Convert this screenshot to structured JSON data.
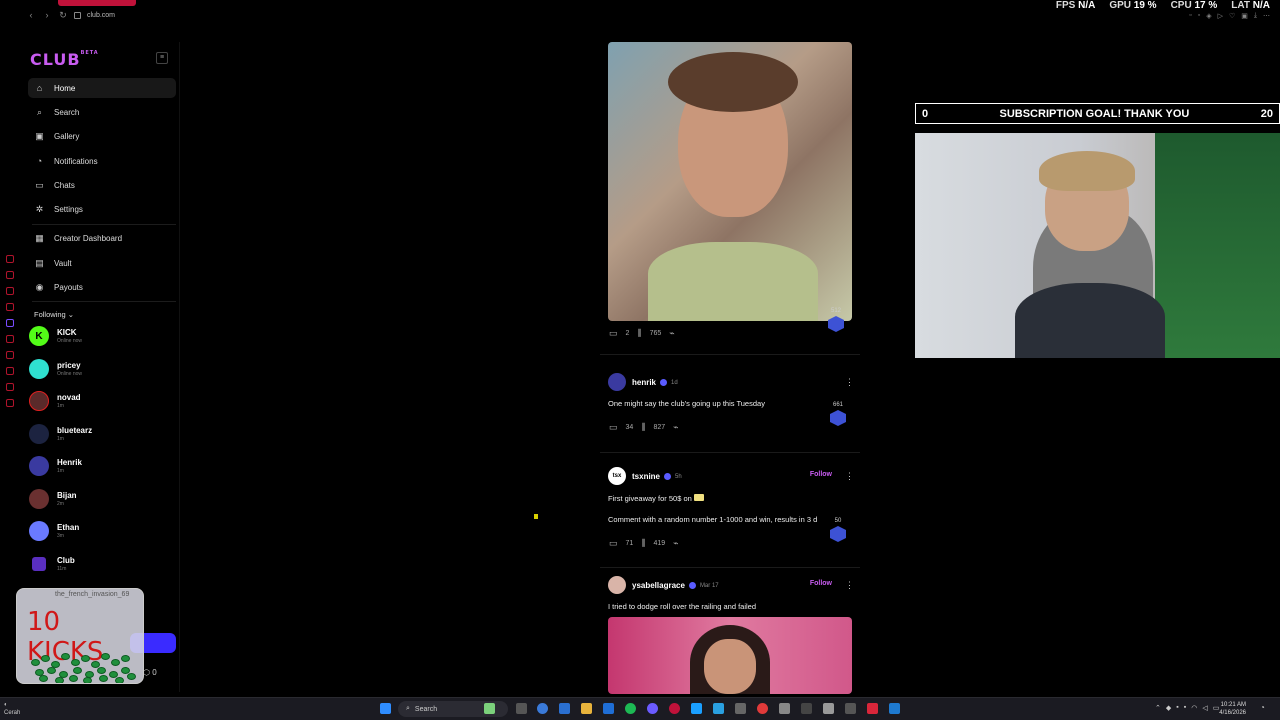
{
  "browser": {
    "url": "club.com",
    "back": "‹",
    "forward": "›",
    "reload": "↻"
  },
  "hud": {
    "fps_label": "FPS",
    "fps_value": "N/A",
    "gpu_label": "GPU",
    "gpu_value": "19 %",
    "cpu_label": "CPU",
    "cpu_value": "17 %",
    "lat_label": "LAT",
    "lat_value": "N/A"
  },
  "sidebar": {
    "logo": "CLUB",
    "logo_badge": "BETA",
    "menu_icon": "≡",
    "nav": [
      {
        "label": "Home",
        "icon": "home-icon",
        "glyph": "⌂",
        "active": true
      },
      {
        "label": "Search",
        "icon": "search-icon",
        "glyph": "⌕"
      },
      {
        "label": "Gallery",
        "icon": "gallery-icon",
        "glyph": "▣"
      },
      {
        "label": "Notifications",
        "icon": "bell-icon",
        "glyph": "◔"
      },
      {
        "label": "Chats",
        "icon": "chat-icon",
        "glyph": "▭"
      },
      {
        "label": "Settings",
        "icon": "gear-icon",
        "glyph": "✲"
      },
      {
        "label": "Creator Dashboard",
        "icon": "dashboard-icon",
        "glyph": "▦"
      },
      {
        "label": "Vault",
        "icon": "vault-icon",
        "glyph": "▤"
      },
      {
        "label": "Payouts",
        "icon": "payouts-icon",
        "glyph": "◉"
      }
    ],
    "following_label": "Following ⌄",
    "following": [
      {
        "name": "KICK",
        "status": "Online now",
        "color": "#53fc18"
      },
      {
        "name": "pricey",
        "status": "Online now",
        "color": "#2fe0d0"
      },
      {
        "name": "novad",
        "status": "1m",
        "color": "#5a2a2a"
      },
      {
        "name": "bluetearz",
        "status": "1m",
        "color": "#1c2340"
      },
      {
        "name": "Henrik",
        "status": "1m",
        "color": "#3a3aa0"
      },
      {
        "name": "Bijan",
        "status": "2m",
        "color": "#6a3030"
      },
      {
        "name": "Ethan",
        "status": "3m",
        "color": "#6a7aff"
      },
      {
        "name": "Club",
        "status": "11m",
        "color": "#5a2fc0"
      }
    ],
    "overlay_user": "the_french_invasion_69",
    "kicks_label": "10 KICKS",
    "counter": "0"
  },
  "feed": {
    "post1": {
      "comments": "2",
      "views": "765",
      "badge": "512"
    },
    "post2": {
      "user": "henrik",
      "time": "1d",
      "text": "One might say the club's going up this Tuesday",
      "comments": "34",
      "views": "827",
      "badge": "661"
    },
    "post3": {
      "user": "tsxnine",
      "avatar_text": "tsx",
      "time": "5h",
      "follow": "Follow",
      "text1": "First giveaway for 50$ on",
      "text2": "Comment with a random number 1-1000 and win, results in 3 d",
      "comments": "71",
      "views": "419",
      "badge": "50"
    },
    "post4": {
      "user": "ysabellagrace",
      "time": "Mar 17",
      "follow": "Follow",
      "text": "I tried to dodge roll over the railing and failed"
    }
  },
  "stream": {
    "goal_start": "0",
    "goal_text": "SUBSCRIPTION GOAL! THANK YOU",
    "goal_end": "20"
  },
  "taskbar": {
    "search": "Search",
    "time": "10:21 AM",
    "date": "4/16/2026",
    "weather": "Cerah"
  }
}
